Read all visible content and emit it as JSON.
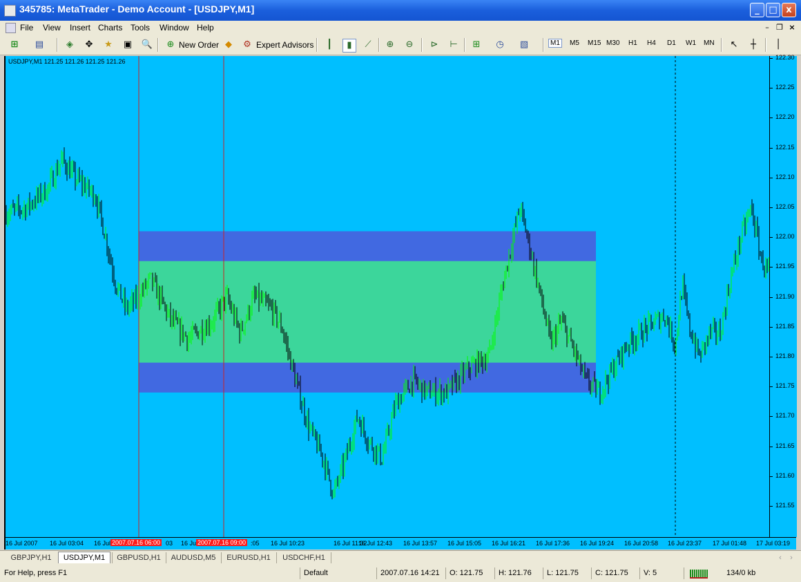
{
  "window": {
    "title": "345785: MetaTrader - Demo Account - [USDJPY,M1]",
    "caption_buttons": [
      "_",
      "□",
      "x"
    ]
  },
  "menu": [
    "File",
    "View",
    "Insert",
    "Charts",
    "Tools",
    "Window",
    "Help"
  ],
  "toolbar": {
    "new_order": "New Order",
    "expert_advisors": "Expert Advisors",
    "timeframes": [
      "M1",
      "M5",
      "M15",
      "M30",
      "H1",
      "H4",
      "D1",
      "W1",
      "MN"
    ],
    "active_timeframe": "M1"
  },
  "chart": {
    "info": "USDJPY,M1  121.25 121.26 121.25 121.26",
    "background": "#00bfff",
    "bull_color": "#00ff00",
    "bear_color": "#000000",
    "zone_outer_color": "#4169e1",
    "zone_inner_color": "#3cd69b",
    "price_labels": [
      "122.30",
      "122.25",
      "122.20",
      "122.15",
      "122.10",
      "122.05",
      "122.00",
      "121.95",
      "121.90",
      "121.85",
      "121.80",
      "121.75",
      "121.70",
      "121.65",
      "121.60",
      "121.55"
    ],
    "time_labels": [
      "16 Jul 2007",
      "16 Jul 03:04",
      "16 Jul",
      "16 Jul",
      "16 Jul 10:23",
      "16 Jul 11:32",
      "16 Jul 12:43",
      "16 Jul 13:57",
      "16 Jul 15:05",
      "16 Jul 16:21",
      "16 Jul 17:36",
      "16 Jul 19:24",
      "16 Jul 20:58",
      "16 Jul 23:37",
      "17 Jul 01:48",
      "17 Jul 03:19"
    ],
    "time_fragments": [
      "03",
      ":05"
    ],
    "vline_labels": [
      "2007.07.16 06:00",
      "2007.07.16 09:00"
    ],
    "zones": {
      "outer": [
        121.74,
        122.01
      ],
      "inner": [
        121.79,
        121.96
      ]
    }
  },
  "tabs": [
    "GBPJPY,H1",
    "USDJPY,M1",
    "GBPUSD,H1",
    "AUDUSD,M5",
    "EURUSD,H1",
    "USDCHF,H1"
  ],
  "active_tab": "USDJPY,M1",
  "status": {
    "help": "For Help, press F1",
    "profile": "Default",
    "datetime": "2007.07.16 14:21",
    "open": "O: 121.75",
    "high": "H: 121.76",
    "low": "L: 121.75",
    "close": "C: 121.75",
    "volume": "V: 5",
    "traffic": "134/0 kb"
  }
}
